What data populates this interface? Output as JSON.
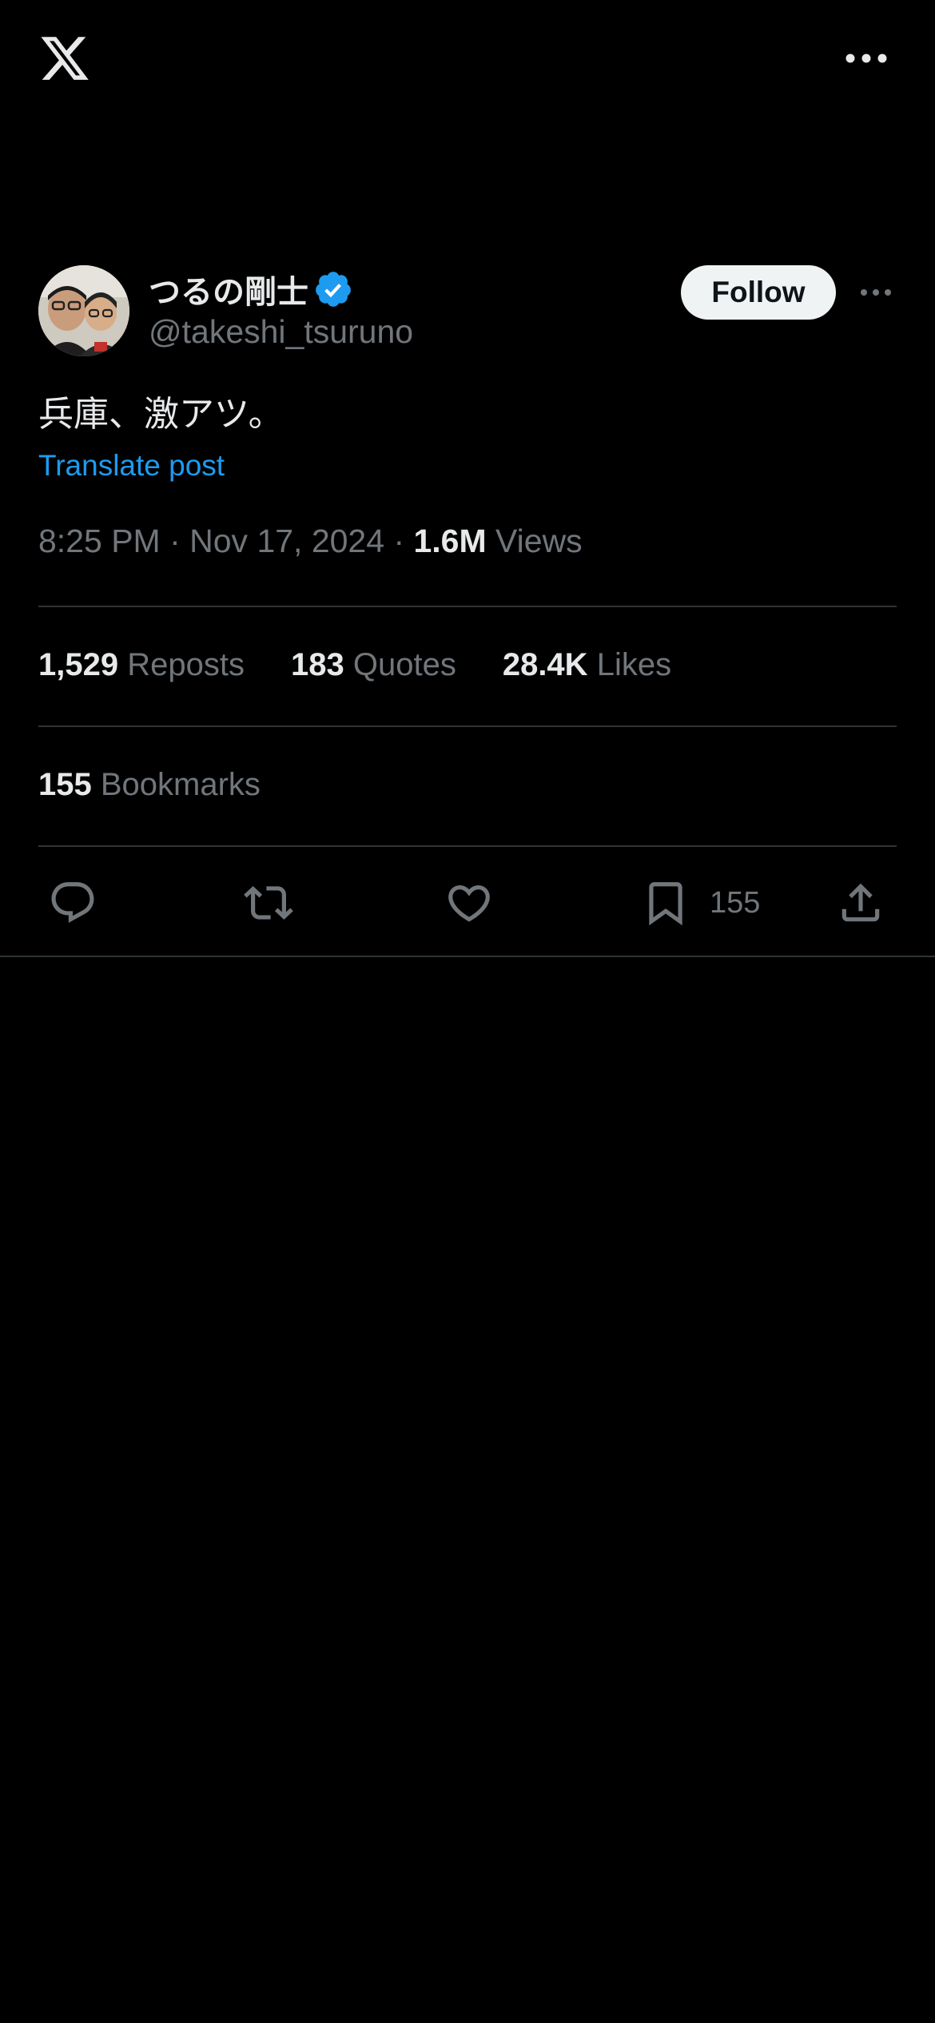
{
  "app": {
    "logo": "x-logo-icon",
    "top_menu": "more-horizontal-icon"
  },
  "author": {
    "display_name": "つるの剛士",
    "handle": "@takeshi_tsuruno",
    "verified": true,
    "verified_color": "#1d9bf0",
    "avatar": "avatar-photo"
  },
  "follow_button": {
    "label": "Follow"
  },
  "post": {
    "text": "兵庫、激アツ。",
    "translate_label": "Translate post",
    "time": "8:25 PM",
    "date": "Nov 17, 2024",
    "separator": " · ",
    "views_count": "1.6M",
    "views_label": "Views"
  },
  "stats": {
    "reposts_count": "1,529",
    "reposts_label": "Reposts",
    "quotes_count": "183",
    "quotes_label": "Quotes",
    "likes_count": "28.4K",
    "likes_label": "Likes",
    "bookmarks_count": "155",
    "bookmarks_label": "Bookmarks"
  },
  "actions": {
    "reply": "reply-icon",
    "repost": "repost-icon",
    "like": "heart-icon",
    "bookmark": "bookmark-icon",
    "bookmark_count": "155",
    "share": "share-icon"
  },
  "colors": {
    "background": "#000000",
    "primary_text": "#e7e9ea",
    "secondary_text": "#71767b",
    "link": "#1d9bf0",
    "divider": "#2f3336"
  }
}
